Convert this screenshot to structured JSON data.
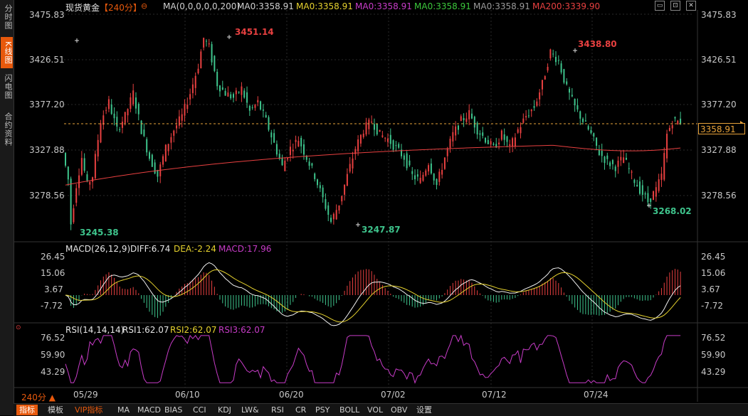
{
  "sidebar": {
    "tabs": [
      {
        "label": "分时图",
        "active": false
      },
      {
        "label": "K线图",
        "active": true
      },
      {
        "label": "闪电图",
        "active": false
      },
      {
        "label": "合约资料",
        "active": false
      }
    ]
  },
  "header": {
    "title": "现货黄金",
    "period": "【240分】",
    "ma_params": "MA(0,0,0,0,0,200)",
    "ma_values": [
      {
        "text": "MA0:3358.91",
        "color": "#d0d0d0"
      },
      {
        "text": "MA0:3358.91",
        "color": "#e6d22e"
      },
      {
        "text": "MA0:3358.91",
        "color": "#c83cc8"
      },
      {
        "text": "MA0:3358.91",
        "color": "#3cc83c"
      },
      {
        "text": "MA0:3358.91",
        "color": "#9a9a9a"
      },
      {
        "text": "MA200:3339.90",
        "color": "#e84040"
      }
    ]
  },
  "main_chart": {
    "y_ticks": [
      "3475.83",
      "3426.51",
      "3377.20",
      "3327.88",
      "3278.56"
    ],
    "y_tick_values": [
      3475.83,
      3426.51,
      3377.2,
      3327.88,
      3278.56
    ],
    "current_price": "3358.91",
    "annotations": [
      "3451.14",
      "3438.80",
      "3245.38",
      "3247.87",
      "3268.02"
    ]
  },
  "macd": {
    "title": "MACD(26,12,9)",
    "diff": "DIFF:6.74",
    "dea": "DEA:-2.24",
    "macd": "MACD:17.96",
    "y_ticks": [
      "26.45",
      "15.06",
      "3.67",
      "-7.72"
    ]
  },
  "rsi": {
    "title": "RSI(14,14,14)",
    "rsi1": "RSI1:62.07",
    "rsi2": "RSI2:62.07",
    "rsi3": "RSI3:62.07",
    "y_ticks": [
      "76.52",
      "59.90",
      "43.29"
    ]
  },
  "x_axis": {
    "period_label": "240分",
    "dates": [
      "05/29",
      "06/10",
      "06/20",
      "07/02",
      "07/12",
      "07/24"
    ]
  },
  "bottom_bar": {
    "items": [
      "指标",
      "模板",
      "VIP指标",
      "MA",
      "MACD",
      "BIAS",
      "CCI",
      "KDJ",
      "LW&",
      "RSI",
      "CR",
      "PSY",
      "BOLL",
      "VOL",
      "OBV",
      "设置"
    ]
  },
  "colors": {
    "up": "#e84040",
    "down": "#3ec48c",
    "accent": "#e8590c",
    "price_line": "#e8a33a"
  },
  "chart_data": {
    "type": "candlestick",
    "title": "现货黄金【240分】",
    "x": [
      "05/29",
      "06/10",
      "06/20",
      "07/02",
      "07/12",
      "07/24"
    ],
    "ylim": [
      3245,
      3476
    ],
    "highs_lows": {
      "high1": 3451.14,
      "high2": 3438.8,
      "low1": 3245.38,
      "low2": 3247.87,
      "low3": 3268.02
    },
    "last": 3358.91,
    "ma200": 3339.9
  }
}
